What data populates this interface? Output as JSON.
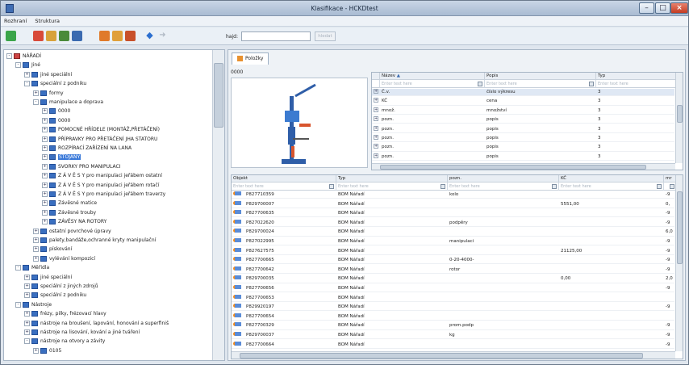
{
  "window": {
    "title": "Klasifikace - HCKDtest"
  },
  "menu": [
    "Rozhraní",
    "Struktura"
  ],
  "search": {
    "label": "hajd:",
    "value": "",
    "button": "hledat"
  },
  "tree": [
    {
      "label": "NÁŘADÍ",
      "level": 0,
      "exp": "-"
    },
    {
      "label": "Jiné",
      "level": 1,
      "exp": "-"
    },
    {
      "label": "jiné speciální",
      "level": 2,
      "exp": "+"
    },
    {
      "label": "speciální z podniku",
      "level": 2,
      "exp": "-"
    },
    {
      "label": "formy",
      "level": 3,
      "exp": "+"
    },
    {
      "label": "manipulace a doprava",
      "level": 3,
      "exp": "-"
    },
    {
      "label": "0000",
      "level": 4,
      "exp": "+"
    },
    {
      "label": "0000",
      "level": 4,
      "exp": "+"
    },
    {
      "label": "POMOCNÉ HŘÍDELE (MONTÁŽ,PŘETÁČENÍ)",
      "level": 4,
      "exp": "+"
    },
    {
      "label": "PŘÍPRAVKY PRO PŘETÁČENÍ JHA STATORU",
      "level": 4,
      "exp": "+"
    },
    {
      "label": "ROZPÍRACÍ ZAŘÍZENÍ NA LANA",
      "level": 4,
      "exp": "+"
    },
    {
      "label": "STOJANY",
      "level": 4,
      "exp": "+",
      "selected": true
    },
    {
      "label": "SVORKY PRO MANIPULACI",
      "level": 4,
      "exp": "+"
    },
    {
      "label": "Z Á V Ě S Y pro manipulaci jeřábem ostatní",
      "level": 4,
      "exp": "+"
    },
    {
      "label": "Z Á V Ě S Y pro manipulaci jeřábem rotačí",
      "level": 4,
      "exp": "+"
    },
    {
      "label": "Z Á V Ě S Y pro manipulaci jeřábem traverzy",
      "level": 4,
      "exp": "+"
    },
    {
      "label": "Závěsné matice",
      "level": 4,
      "exp": "+"
    },
    {
      "label": "Závěsné trouby",
      "level": 4,
      "exp": "+"
    },
    {
      "label": "ZÁVĚSY NA ROTORY",
      "level": 4,
      "exp": "+"
    },
    {
      "label": "ostatní povrchové úpravy",
      "level": 3,
      "exp": "+"
    },
    {
      "label": "palety,bandáže,ochranné kryty manipulační",
      "level": 3,
      "exp": "+"
    },
    {
      "label": "pískování",
      "level": 3,
      "exp": "+"
    },
    {
      "label": "vylévání kompozicí",
      "level": 3,
      "exp": "+"
    },
    {
      "label": "Měřidla",
      "level": 1,
      "exp": "-"
    },
    {
      "label": "jiné speciální",
      "level": 2,
      "exp": "+"
    },
    {
      "label": "speciální z jiných zdrojů",
      "level": 2,
      "exp": "+"
    },
    {
      "label": "speciální z podniku",
      "level": 2,
      "exp": "+"
    },
    {
      "label": "Nástroje",
      "level": 1,
      "exp": "-"
    },
    {
      "label": "frézy, pilky, frézovací hlavy",
      "level": 2,
      "exp": "+"
    },
    {
      "label": "nástroje na broušení, lapování, honování a superfiniš",
      "level": 2,
      "exp": "+"
    },
    {
      "label": "nástroje na lisování, kování a jiné tváření",
      "level": 2,
      "exp": "+"
    },
    {
      "label": "nástroje na otvory a závity",
      "level": 2,
      "exp": "-"
    },
    {
      "label": "0105",
      "level": 3,
      "exp": "+"
    }
  ],
  "tab": {
    "label": "Položky"
  },
  "item_code": "0000",
  "attr_grid": {
    "columns": [
      "Název",
      "Popis",
      "Typ"
    ],
    "filter_placeholder": "Enter text here",
    "rows": [
      {
        "name": "Č.v.",
        "desc": "číslo výkresu",
        "type": "3"
      },
      {
        "name": "KČ",
        "desc": "cena",
        "type": "3"
      },
      {
        "name": "množ.",
        "desc": "množství",
        "type": "3"
      },
      {
        "name": "pozn.",
        "desc": "popis",
        "type": "3"
      },
      {
        "name": "pozn.",
        "desc": "popis",
        "type": "3"
      },
      {
        "name": "pozn.",
        "desc": "popis",
        "type": "3"
      },
      {
        "name": "pozn.",
        "desc": "popis",
        "type": "3"
      },
      {
        "name": "pozn.",
        "desc": "popis",
        "type": "3"
      }
    ]
  },
  "item_grid": {
    "columns": [
      "Objekt",
      "Typ",
      "pozn.",
      "KČ",
      "mr"
    ],
    "filter_placeholder": "Enter text here",
    "rows": [
      {
        "obj": "P827710359",
        "typ": "BOM Nářadí",
        "pozn": "kolo",
        "kc": "",
        "mr": "-9"
      },
      {
        "obj": "P829700007",
        "typ": "BOM Nářadí",
        "pozn": "",
        "kc": "5551,00",
        "mr": "0,"
      },
      {
        "obj": "P827700635",
        "typ": "BOM Nářadí",
        "pozn": "",
        "kc": "",
        "mr": "-9"
      },
      {
        "obj": "P827022620",
        "typ": "BOM Nářadí",
        "pozn": "podpěry",
        "kc": "",
        "mr": "-9"
      },
      {
        "obj": "P829700024",
        "typ": "BOM Nářadí",
        "pozn": "",
        "kc": "",
        "mr": "6,0"
      },
      {
        "obj": "P827022995",
        "typ": "BOM Nářadí",
        "pozn": "manipulaci",
        "kc": "",
        "mr": "-9"
      },
      {
        "obj": "P827627575",
        "typ": "BOM Nářadí",
        "pozn": "",
        "kc": "21125,00",
        "mr": "-9"
      },
      {
        "obj": "P827700665",
        "typ": "BOM Nářadí",
        "pozn": "0-20-4000-",
        "kc": "",
        "mr": "-9"
      },
      {
        "obj": "P827700642",
        "typ": "BOM Nářadí",
        "pozn": "rotor",
        "kc": "",
        "mr": "-9"
      },
      {
        "obj": "P829700035",
        "typ": "BOM Nářadí",
        "pozn": "",
        "kc": "0,00",
        "mr": "2,0"
      },
      {
        "obj": "P827700656",
        "typ": "BOM Nářadí",
        "pozn": "",
        "kc": "",
        "mr": "-9"
      },
      {
        "obj": "P827700653",
        "typ": "BOM Nářadí",
        "pozn": "",
        "kc": "",
        "mr": ""
      },
      {
        "obj": "P829920197",
        "typ": "BOM Nářadí",
        "pozn": "",
        "kc": "",
        "mr": "-9"
      },
      {
        "obj": "P827700654",
        "typ": "BOM Nářadí",
        "pozn": "",
        "kc": "",
        "mr": ""
      },
      {
        "obj": "P827700329",
        "typ": "BOM Nářadí",
        "pozn": "prom.podp",
        "kc": "",
        "mr": "-9"
      },
      {
        "obj": "P829700037",
        "typ": "BOM Nářadí",
        "pozn": "kg",
        "kc": "",
        "mr": "-9"
      },
      {
        "obj": "P827700664",
        "typ": "BOM Nářadí",
        "pozn": "",
        "kc": "",
        "mr": "-9"
      }
    ]
  }
}
